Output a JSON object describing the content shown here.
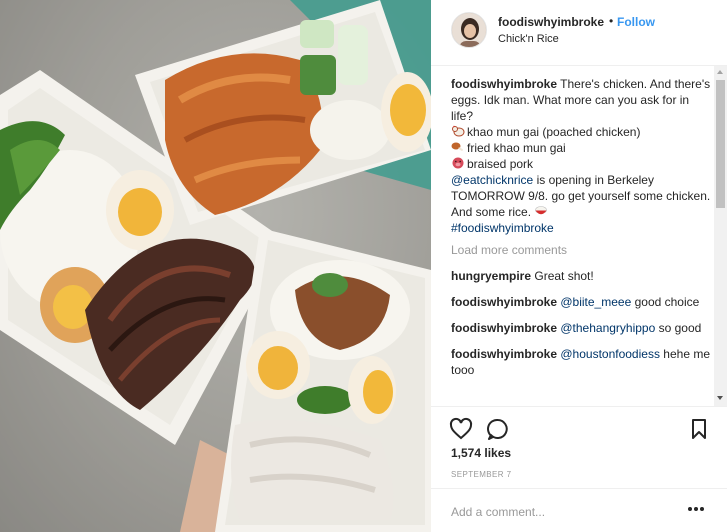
{
  "header": {
    "username": "foodiswhyimbroke",
    "separator": "•",
    "follow_label": "Follow",
    "location": "Chick'n Rice"
  },
  "caption": {
    "username": "foodiswhyimbroke",
    "text": "There's chicken. And there's eggs. Idk man. What more can you ask for in life?",
    "item1": "khao mun gai (poached chicken)",
    "item2": "fried khao mun gai",
    "item3": "braised pork",
    "mention": "@eatchicknrice",
    "announcement": "is opening in Berkeley TOMORROW 9/8. go get yourself some chicken. And some rice.",
    "hashtag": "#foodiswhyimbroke"
  },
  "load_more_label": "Load more comments",
  "comments": [
    {
      "username": "hungryempire",
      "mention": "",
      "text": "Great shot!"
    },
    {
      "username": "foodiswhyimbroke",
      "mention": "@biite_meee",
      "text": "good choice"
    },
    {
      "username": "foodiswhyimbroke",
      "mention": "@thehangryhippo",
      "text": "so good"
    },
    {
      "username": "foodiswhyimbroke",
      "mention": "@houstonfoodiess",
      "text": "hehe me tooo"
    }
  ],
  "likes": "1,574 likes",
  "date": "SEPTEMBER 7",
  "add_comment_placeholder": "Add a comment...",
  "icons": {
    "like": "heart-icon",
    "comment": "comment-bubble-icon",
    "save": "bookmark-icon",
    "options": "more-options-icon"
  },
  "colors": {
    "follow": "#3897f0",
    "mention": "#003569",
    "muted": "#999999",
    "text": "#262626"
  }
}
